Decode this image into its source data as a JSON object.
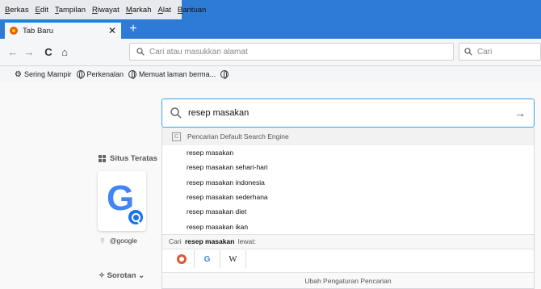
{
  "menu": [
    "Berkas",
    "Edit",
    "Tampilan",
    "Riwayat",
    "Markah",
    "Alat",
    "Bantuan"
  ],
  "menu_underline": [
    "B",
    "E",
    "T",
    "R",
    "M",
    "A",
    "B"
  ],
  "tab": {
    "title": "Tab Baru",
    "close": "✕",
    "new": "+"
  },
  "nav": {
    "back": "←",
    "forward": "→",
    "reload": "C",
    "home": "⌂",
    "url_placeholder": "Cari atau masukkan alamat",
    "search_placeholder": "Cari"
  },
  "bookmarks": [
    {
      "label": "Sering Mampir",
      "icon": "gear-icon"
    },
    {
      "label": "Perkenalan",
      "icon": "globe-icon"
    },
    {
      "label": "Memuat laman berma...",
      "icon": "globe-icon"
    },
    {
      "label": "",
      "icon": "globe-icon"
    }
  ],
  "search": {
    "query": "resep masakan",
    "go": "→",
    "engine_header": "Pencarian Default Search Engine",
    "suggestions": [
      "resep masakan",
      "resep masakan sehari-hari",
      "resep masakan indonesia",
      "resep masakan sederhana",
      "resep masakan diet",
      "resep masakan ikan"
    ],
    "search_with_prefix": "Cari",
    "search_with_query": "resep masakan",
    "search_with_suffix": "lewat:",
    "engine_g": "G",
    "engine_w": "W",
    "footer": "Ubah Pengaturan Pencarian"
  },
  "topsites": {
    "heading": "Situs Teratas",
    "chevron": "⌄",
    "tile_label": "@google",
    "tile_letter": "G"
  },
  "highlights": {
    "heading": "Sorotan ⌄"
  },
  "colors": {
    "accent": "#0a84ff",
    "focus_ring": "#3ba4e8",
    "titlebar": "#2e7bd6"
  }
}
